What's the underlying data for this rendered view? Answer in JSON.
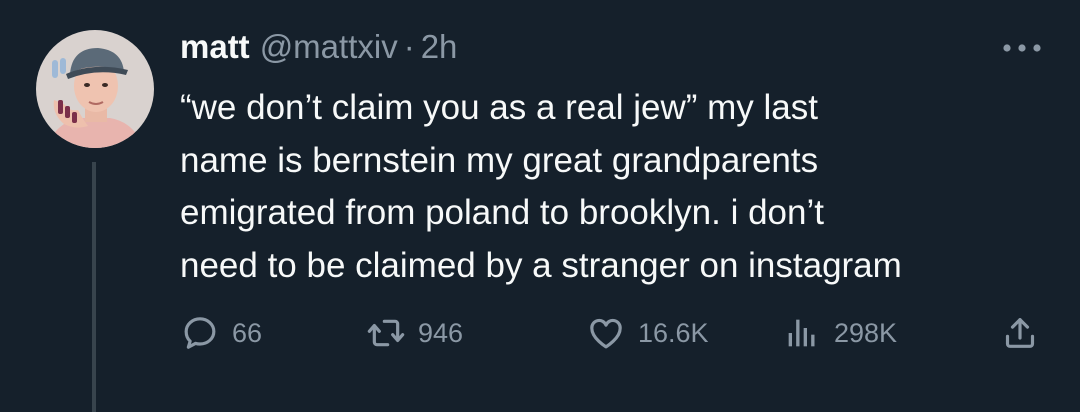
{
  "tweet": {
    "author_name": "matt",
    "author_handle": "@mattxiv",
    "separator": "·",
    "time_ago": "2h",
    "text_lines": [
      "“we don’t claim you as a real jew” my last",
      "name is bernstein my great grandparents",
      "emigrated from poland to brooklyn. i don’t",
      "need to be claimed by a stranger on instagram"
    ],
    "stats": {
      "replies": "66",
      "retweets": "946",
      "likes": "16.6K",
      "views": "298K"
    }
  },
  "icons": {
    "more": "more-horizontal-icon",
    "reply": "reply-icon",
    "retweet": "retweet-icon",
    "like": "heart-icon",
    "views": "views-bar-chart-icon",
    "share": "share-upload-icon"
  },
  "colors": {
    "background": "#15202b",
    "text_primary": "#f7f9f9",
    "text_secondary": "#8b98a5",
    "thread_line": "#38444d"
  }
}
